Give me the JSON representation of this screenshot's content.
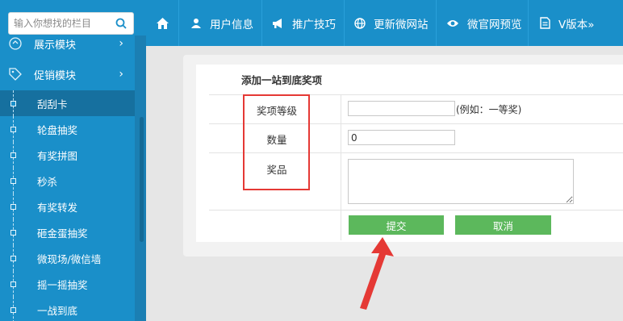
{
  "sidebar": {
    "search_placeholder": "输入你想找的栏目",
    "top_partial_label": "展示模块",
    "section_label": "促销模块",
    "chevron": "›",
    "items": [
      {
        "label": "刮刮卡",
        "active": true
      },
      {
        "label": "轮盘抽奖",
        "active": false
      },
      {
        "label": "有奖拼图",
        "active": false
      },
      {
        "label": "秒杀",
        "active": false
      },
      {
        "label": "有奖转发",
        "active": false
      },
      {
        "label": "砸金蛋抽奖",
        "active": false
      },
      {
        "label": "微现场/微信墙",
        "active": false
      },
      {
        "label": "摇一摇抽奖",
        "active": false
      },
      {
        "label": "一战到底",
        "active": false
      }
    ]
  },
  "topnav": {
    "items": [
      {
        "label": "用户信息",
        "icon": "user-icon"
      },
      {
        "label": "推广技巧",
        "icon": "megaphone-icon"
      },
      {
        "label": "更新微网站",
        "icon": "globe-icon"
      },
      {
        "label": "微官网预览",
        "icon": "eye-icon"
      },
      {
        "label": "V版本»",
        "icon": "document-icon"
      }
    ]
  },
  "form": {
    "title": "添加一站到底奖项",
    "level_label": "奖项等级",
    "level_value": "",
    "level_hint": "(例如：一等奖)",
    "quantity_label": "数量",
    "quantity_value": "0",
    "prize_label": "奖品",
    "prize_value": "",
    "submit_label": "提交",
    "cancel_label": "取消"
  },
  "colors": {
    "brand_blue": "#1a8fc9",
    "button_green": "#5cb85c",
    "annotation_red": "#e53935"
  }
}
